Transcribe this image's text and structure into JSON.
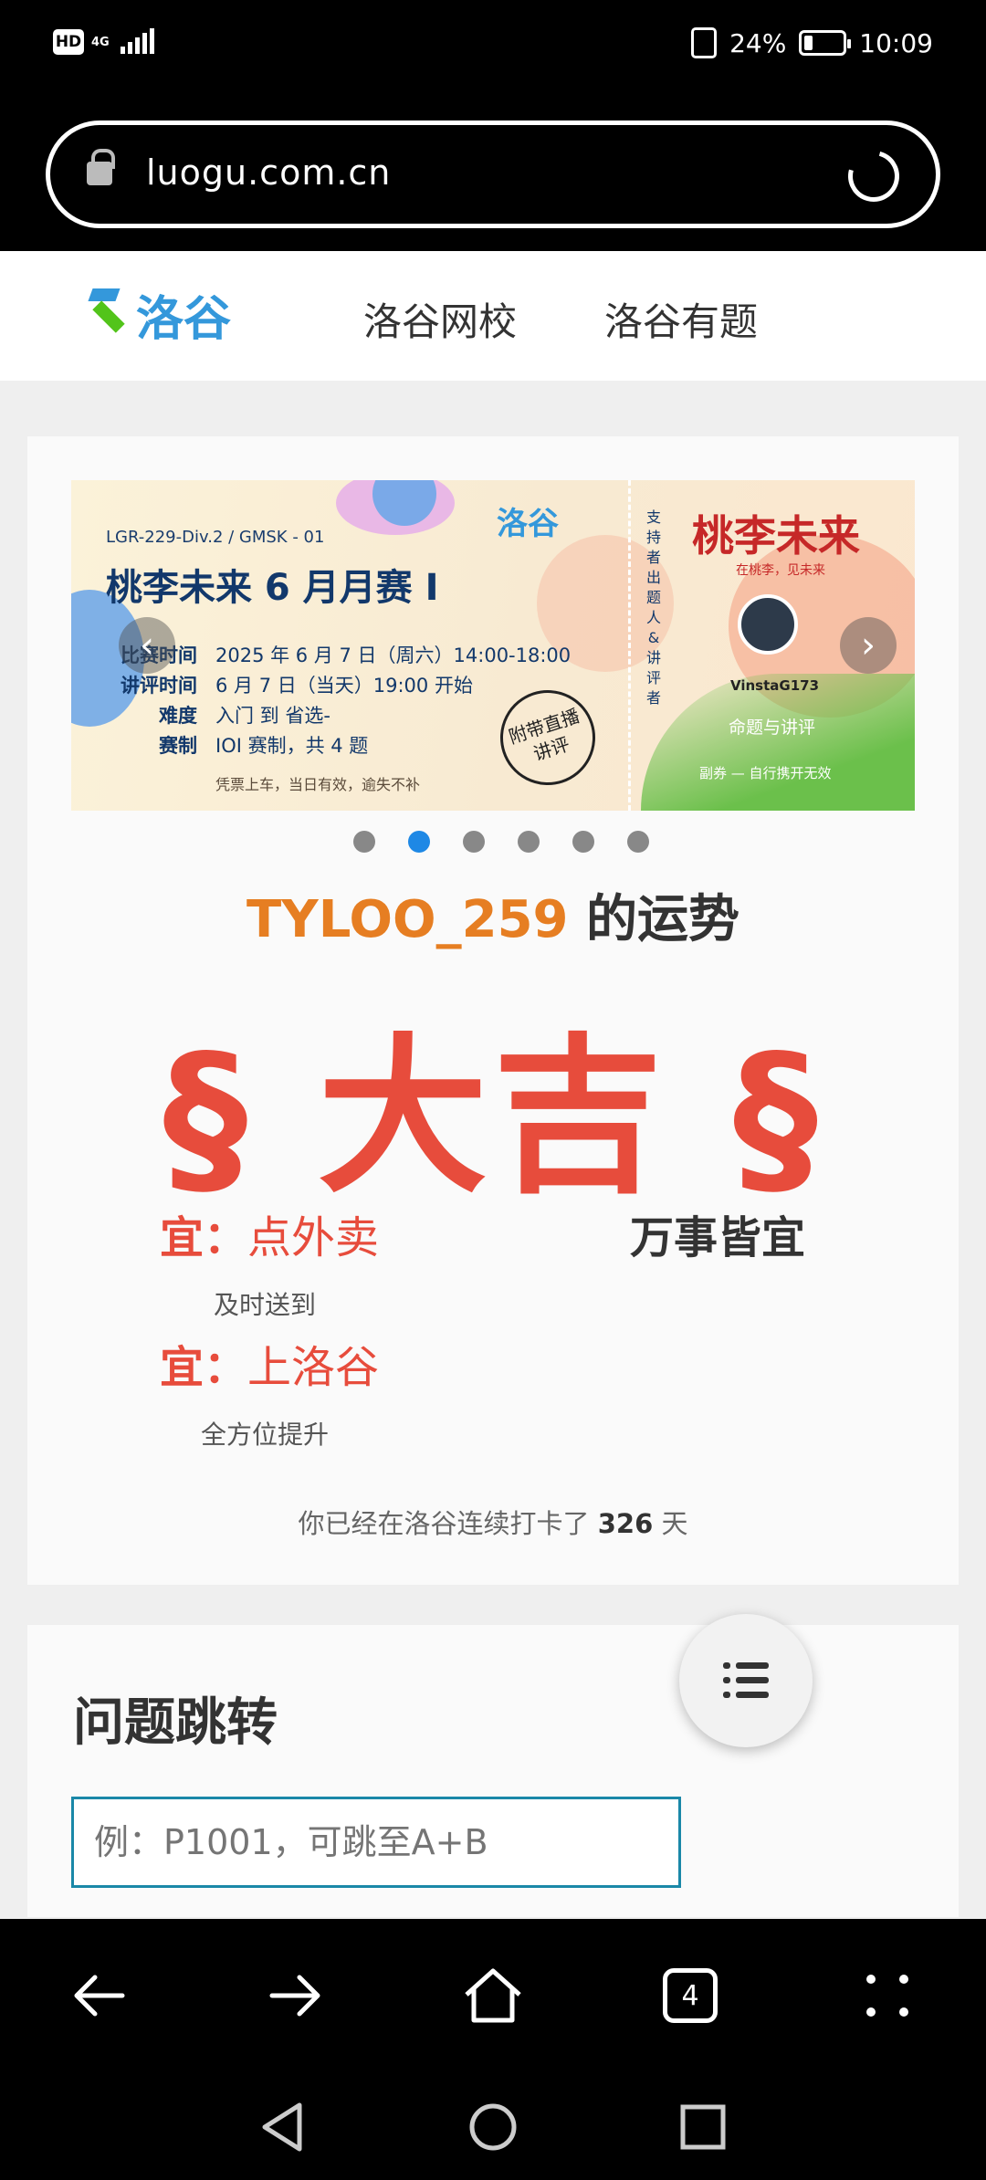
{
  "status": {
    "hd": "HD",
    "net": "4G",
    "battery": "24%",
    "time": "10:09"
  },
  "browser": {
    "url": "luogu.com.cn",
    "tab_count": "4"
  },
  "site": {
    "logo_text": "洛谷",
    "nav": [
      "洛谷网校",
      "洛谷有题"
    ]
  },
  "banner": {
    "tag": "LGR-229-Div.2 / GMSK - 01",
    "title": "桃李未来 6 月月赛 I",
    "info": [
      {
        "k": "比赛时间",
        "v": "2025 年 6 月 7 日（周六）14:00-18:00"
      },
      {
        "k": "讲评时间",
        "v": "6 月 7 日（当天）19:00 开始"
      },
      {
        "k": "难度",
        "v": "入门 到 省选-"
      },
      {
        "k": "赛制",
        "v": "IOI 赛制，共 4 题"
      }
    ],
    "footer": "凭票上车，当日有效，逾失不补",
    "logo": "洛谷",
    "stamp": "附带直播讲评",
    "support_vertical": "支持者 出题人&讲评者",
    "brand": "桃李未来",
    "brand_sub": "在桃李，见未来",
    "author": "VinstaG173",
    "role": "命题与讲评",
    "role_foot": "副券 — 自行携开无效",
    "dots": 6,
    "active_dot": 1
  },
  "fortune": {
    "username": "TYLOO_259",
    "title_suffix": " 的运势",
    "result": "§ 大吉 §",
    "yi1_label": "宜：",
    "yi1_value": "点外卖",
    "yi1_sub": "及时送到",
    "yi2_label": "宜：",
    "yi2_value": "上洛谷",
    "yi2_sub": "全方位提升",
    "all_good": "万事皆宜",
    "streak_prefix": "你已经在洛谷连续打卡了 ",
    "streak_days": "326",
    "streak_suffix": " 天"
  },
  "jump": {
    "title": "问题跳转",
    "placeholder": "例：P1001，可跳至A+B"
  },
  "colors": {
    "accent": "#3498db",
    "lucky": "#e74c3c",
    "username": "#e67e22"
  }
}
